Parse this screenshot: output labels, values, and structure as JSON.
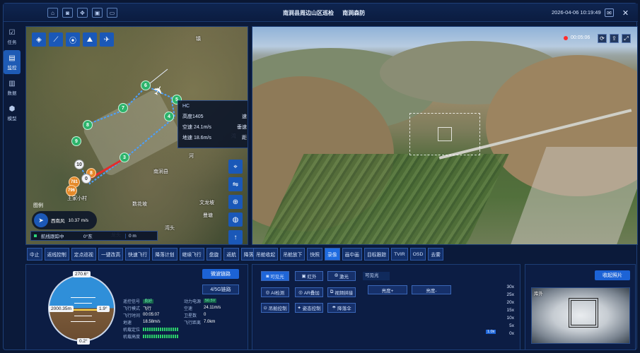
{
  "header": {
    "title": "南涧县周边山区巡检",
    "subtitle": "南涧森防",
    "datetime": "2026-04-06 10:19:49",
    "top_icons": [
      "home-icon",
      "camera-icon",
      "drone-icon",
      "screen-icon",
      "monitor-icon"
    ]
  },
  "nav": [
    {
      "label": "任务",
      "icon": "task-icon",
      "active": false
    },
    {
      "label": "监控",
      "icon": "monitor-icon",
      "active": true
    },
    {
      "label": "数据",
      "icon": "chart-icon",
      "active": false
    },
    {
      "label": "模型",
      "icon": "cube-icon",
      "active": false
    }
  ],
  "map": {
    "town_labels": [
      "镇",
      "湾",
      "河",
      "南涧县",
      "数花坡",
      "文龙坡",
      "曼塘",
      "王家小村",
      "湾头",
      "龙头"
    ],
    "waypoints": [
      "5",
      "6",
      "7",
      "4",
      "8",
      "9",
      "3",
      "10",
      "8",
      "0",
      "781",
      "796"
    ],
    "info_card": {
      "code": "HC",
      "altitude_label": "高度1405",
      "airspeed": "空速 24.1m/s",
      "groundspeed": "地速 18.6m/s",
      "right_col": [
        "速",
        "垂速",
        "距"
      ]
    },
    "legend": "图例",
    "wind": {
      "direction": "西南风",
      "speed": "10.37 m/s"
    },
    "track": {
      "label": "航线跟踪中",
      "heading": "0°东",
      "distance": "0 m"
    }
  },
  "video": {
    "rec_time": "00:05:06",
    "icons": [
      "refresh-icon",
      "share-icon",
      "fullscreen-icon"
    ]
  },
  "flight_toolbar": [
    "中止",
    "返线控制",
    "定点巡视",
    "一键改高",
    "快速飞行",
    "降落计划",
    "继续飞行",
    "盘旋",
    "返航",
    "降落"
  ],
  "camera_toolbar": [
    "吊舱收起",
    "吊舱放下",
    "快照",
    "录像",
    "画中画",
    "目标跟踪",
    "TVIR",
    "OSD",
    "去雾"
  ],
  "flight_panel": {
    "quick_link": "微波链路",
    "link_4g": "4/5G链路",
    "heading": "270.6°",
    "altitude": "2000.35m",
    "pitch": "1.9°",
    "roll": "0.2°",
    "telemetry": [
      {
        "k": "遥控信号",
        "v": "良好",
        "k2": "动力电源",
        "v2": "50.5V"
      },
      {
        "k": "飞行模式",
        "v": "飞行",
        "k2": "空速",
        "v2": "24.11m/s"
      },
      {
        "k": "飞行时间",
        "v": "00:05:07",
        "k2": "卫星数",
        "v2": "0"
      },
      {
        "k": "地速",
        "v": "18.58m/s",
        "k2": "飞行距离",
        "v2": "7.0km"
      },
      {
        "k": "机载定位",
        "v": "",
        "k2": "",
        "v2": ""
      },
      {
        "k": "机载高度",
        "v": "",
        "k2": "",
        "v2": ""
      }
    ]
  },
  "camera_panel": {
    "modes": [
      "可见光",
      "红外",
      "激光"
    ],
    "functions": [
      "AI检测",
      "AR叠加",
      "视频拼接",
      "吊舱控制",
      "姿态控制",
      "降落伞"
    ],
    "tab": "可见光",
    "brightness_plus": "亮度+",
    "brightness_minus": "亮度-",
    "zoom_levels": [
      "30x",
      "25x",
      "20x",
      "15x",
      "10x",
      "5x",
      "0x"
    ],
    "current_zoom": "1.0x"
  },
  "landing_panel": {
    "button": "收起照片",
    "thumb_label": "库外"
  }
}
